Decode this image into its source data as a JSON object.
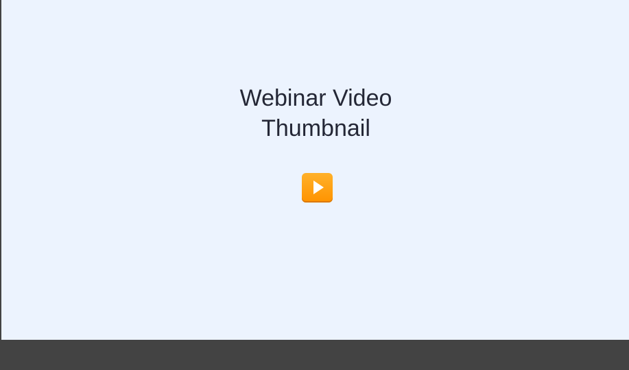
{
  "video": {
    "title_line_1": "Webinar Video",
    "title_line_2": "Thumbnail",
    "play_icon": "play-icon"
  },
  "colors": {
    "thumbnail_background": "#ecf3fe",
    "bar_background": "#434343",
    "title_text": "#242736",
    "play_button": "#ff9300"
  }
}
